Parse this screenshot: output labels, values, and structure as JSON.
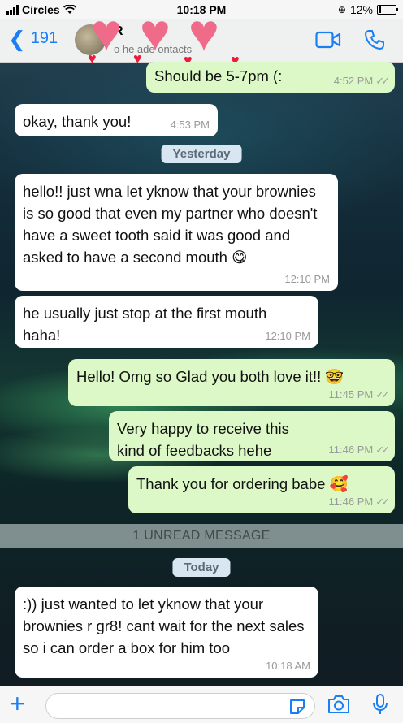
{
  "status_bar": {
    "carrier": "Circles",
    "time": "10:18 PM",
    "battery": "12%"
  },
  "header": {
    "back_count": "191",
    "contact_name": "R",
    "contact_subtitle": "o he ade ontacts"
  },
  "messages": [
    {
      "dir": "out",
      "text": "Should be 5-7pm (:",
      "time": "4:52 PM",
      "ticks": "✓✓"
    },
    {
      "dir": "in",
      "text": "okay, thank you!",
      "time": "4:53 PM"
    },
    {
      "dir": "in",
      "text": "hello!! just wna let yknow that your brownies is so good that even my partner who doesn't have a sweet tooth said it was good and asked to have a second mouth 😋",
      "time": "12:10 PM"
    },
    {
      "dir": "in",
      "text": "he usually just stop at the first mouth haha!",
      "time": "12:10 PM"
    },
    {
      "dir": "out",
      "text": "Hello! Omg so Glad you both love it!! 🤓",
      "time": "11:45 PM",
      "ticks": "✓✓"
    },
    {
      "dir": "out",
      "text": "Very happy to receive this kind of feedbacks hehe",
      "time": "11:46 PM",
      "ticks": "✓✓"
    },
    {
      "dir": "out",
      "text": "Thank you for ordering babe 🥰",
      "time": "11:46 PM",
      "ticks": "✓✓"
    },
    {
      "dir": "in",
      "text": ":)) just wanted to let yknow that your brownies r gr8! cant wait for the next sales so i can order a box for him too",
      "time": "10:18 AM"
    }
  ],
  "separators": {
    "yesterday": "Yesterday",
    "unread": "1 UNREAD MESSAGE",
    "today": "Today"
  },
  "colors": {
    "accent": "#1a7ef5",
    "outgoing": "#dcf8c6",
    "incoming": "#ffffff"
  },
  "icons": [
    "back-chevron-icon",
    "video-call-icon",
    "phone-icon",
    "plus-icon",
    "sticker-icon",
    "camera-icon",
    "mic-icon",
    "heart-icon"
  ]
}
